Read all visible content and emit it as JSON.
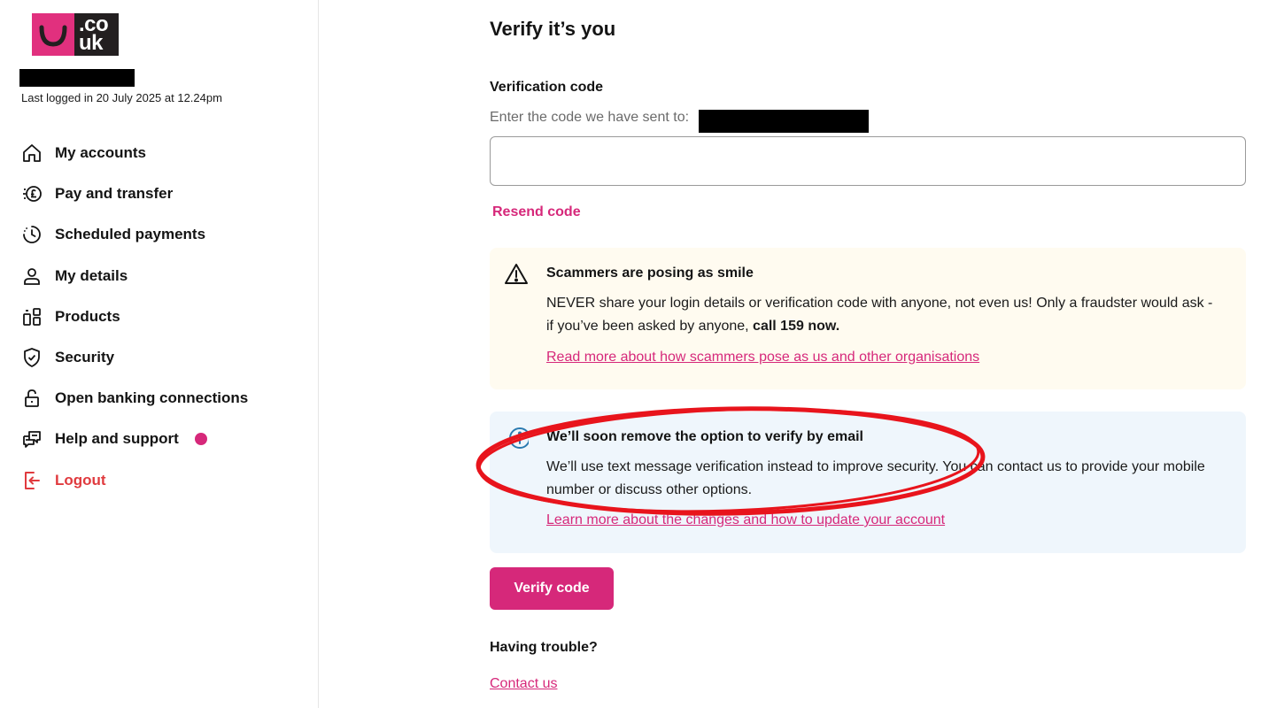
{
  "brand": {
    "logo_text": ".co\nuk",
    "logo_line1": ".co",
    "logo_line2": "uk",
    "accent": "#d6287a",
    "warning": "#e03a3e"
  },
  "sidebar": {
    "last_login": "Last logged in 20 July 2025 at 12.24pm",
    "items": [
      {
        "label": "My accounts",
        "icon": "home-icon"
      },
      {
        "label": "Pay and transfer",
        "icon": "pound-transfer-icon"
      },
      {
        "label": "Scheduled payments",
        "icon": "clock-icon"
      },
      {
        "label": "My details",
        "icon": "person-icon"
      },
      {
        "label": "Products",
        "icon": "products-icon"
      },
      {
        "label": "Security",
        "icon": "shield-check-icon"
      },
      {
        "label": "Open banking connections",
        "icon": "unlocked-padlock-icon"
      },
      {
        "label": "Help and support",
        "icon": "chat-icon",
        "badge": "notification-dot"
      },
      {
        "label": "Logout",
        "icon": "logout-icon"
      }
    ]
  },
  "main": {
    "title": "Verify it’s you",
    "verification": {
      "label": "Verification code",
      "hint": "Enter the code we have sent to:",
      "value": "",
      "resend_label": "Resend code"
    },
    "warning_panel": {
      "icon": "warning-triangle-icon",
      "title": "Scammers are posing as smile",
      "body_text": "NEVER share your login details or verification code with anyone, not even us! Only a fraudster would ask - if you’ve been asked by anyone, ",
      "body_emphasis": "call 159 now.",
      "link": "Read more about how scammers pose as us and other organisations"
    },
    "info_panel": {
      "icon": "info-icon",
      "title": "We’ll soon remove the option to verify by email",
      "body": "We’ll use text message verification instead to improve security. You can contact us to provide your mobile number or discuss other options.",
      "link": "Learn more about the changes and how to update your account"
    },
    "verify_button": "Verify code",
    "trouble_heading": "Having trouble?",
    "contact_link": "Contact us"
  },
  "annotation": {
    "shape": "ellipse",
    "color": "#e8141c"
  }
}
